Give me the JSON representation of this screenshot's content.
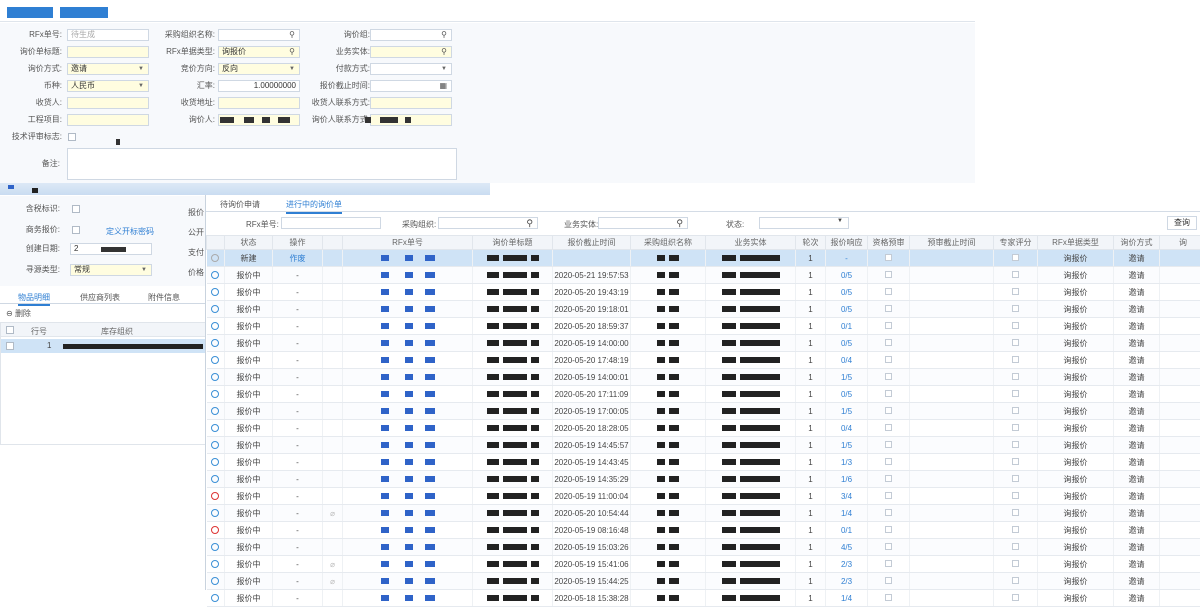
{
  "colors": {
    "accent": "#2f7fd3",
    "selected_row": "#cfe3f6",
    "required": "#fffde0"
  },
  "back_form": {
    "rows": [
      [
        {
          "label": "RFx单号:",
          "value": "待生成",
          "kind": "plain"
        },
        {
          "label": "采购组织名称:",
          "value": "",
          "kind": "search"
        },
        {
          "label": "询价组:",
          "value": "",
          "kind": "search"
        }
      ],
      [
        {
          "label": "询价单标题:",
          "value": "",
          "kind": "req"
        },
        {
          "label": "RFx单据类型:",
          "value": "询报价",
          "kind": "reqsearch"
        },
        {
          "label": "业务实体:",
          "value": "",
          "kind": "reqsearch"
        }
      ],
      [
        {
          "label": "询价方式:",
          "value": "邀请",
          "kind": "reqdd"
        },
        {
          "label": "竞价方向:",
          "value": "反向",
          "kind": "reqdd"
        },
        {
          "label": "付款方式:",
          "value": "",
          "kind": "dd"
        }
      ],
      [
        {
          "label": "币种:",
          "value": "人民币",
          "kind": "reqdd"
        },
        {
          "label": "汇率:",
          "value": "1.00000000",
          "kind": "num"
        },
        {
          "label": "报价截止时间:",
          "value": "",
          "kind": "cal"
        }
      ],
      [
        {
          "label": "收货人:",
          "value": "",
          "kind": "req"
        },
        {
          "label": "收货地址:",
          "value": "",
          "kind": "req"
        },
        {
          "label": "收货人联系方式:",
          "value": "",
          "kind": "req"
        }
      ],
      [
        {
          "label": "工程项目:",
          "value": "",
          "kind": "req"
        },
        {
          "label": "询价人:",
          "value": "",
          "kind": "req"
        },
        {
          "label": "询价人联系方式:",
          "value": "",
          "kind": "req"
        }
      ]
    ],
    "tech_flag_label": "技术评审标志:",
    "remark_label": "备注:",
    "lower": {
      "contains_label": "含税标识:",
      "bid_label": "商务报价:",
      "bid_link": "定义开标密码",
      "created_label": "创建日期:",
      "created_value": "2",
      "purchase_type_label": "寻源类型:",
      "purchase_type_value": "常规",
      "right_labels": [
        "报价",
        "公开",
        "支付",
        "价格"
      ]
    },
    "bottom_tabs": [
      "物品明细",
      "供应商列表",
      "附件信息"
    ],
    "delete_label": "删除",
    "grid_headers": [
      "行号",
      "库存组织"
    ],
    "grid_row_no": "1"
  },
  "front": {
    "tabs": [
      "待询价申请",
      "进行中的询价单"
    ],
    "filters": {
      "rfx_no": "RFx单号:",
      "org": "采购组织:",
      "entity": "业务实体:",
      "status": "状态:",
      "query": "查询"
    },
    "headers": [
      "",
      "状态",
      "操作",
      "",
      "RFx单号",
      "询价单标题",
      "报价截止时间",
      "采购组织名称",
      "业务实体",
      "轮次",
      "报价响应",
      "资格预审",
      "预审截止时间",
      "专家评分",
      "RFx单据类型",
      "询价方式",
      "询"
    ],
    "rows": [
      {
        "icon": "gr",
        "status": "新建",
        "op": "作废",
        "clip": false,
        "deadline": "",
        "round": "1",
        "resp": "-",
        "type": "询报价",
        "method": "邀请"
      },
      {
        "icon": "b",
        "status": "报价中",
        "op": "-",
        "clip": false,
        "deadline": "2020-05-21 19:57:53",
        "round": "1",
        "resp": "0/5",
        "type": "询报价",
        "method": "邀请"
      },
      {
        "icon": "b",
        "status": "报价中",
        "op": "-",
        "clip": false,
        "deadline": "2020-05-20 19:43:19",
        "round": "1",
        "resp": "0/5",
        "type": "询报价",
        "method": "邀请"
      },
      {
        "icon": "b",
        "status": "报价中",
        "op": "-",
        "clip": false,
        "deadline": "2020-05-20 19:18:01",
        "round": "1",
        "resp": "0/5",
        "type": "询报价",
        "method": "邀请"
      },
      {
        "icon": "b",
        "status": "报价中",
        "op": "-",
        "clip": false,
        "deadline": "2020-05-20 18:59:37",
        "round": "1",
        "resp": "0/1",
        "type": "询报价",
        "method": "邀请"
      },
      {
        "icon": "b",
        "status": "报价中",
        "op": "-",
        "clip": false,
        "deadline": "2020-05-19 14:00:00",
        "round": "1",
        "resp": "0/5",
        "type": "询报价",
        "method": "邀请"
      },
      {
        "icon": "b",
        "status": "报价中",
        "op": "-",
        "clip": false,
        "deadline": "2020-05-20 17:48:19",
        "round": "1",
        "resp": "0/4",
        "type": "询报价",
        "method": "邀请"
      },
      {
        "icon": "b",
        "status": "报价中",
        "op": "-",
        "clip": false,
        "deadline": "2020-05-19 14:00:01",
        "round": "1",
        "resp": "1/5",
        "type": "询报价",
        "method": "邀请"
      },
      {
        "icon": "b",
        "status": "报价中",
        "op": "-",
        "clip": false,
        "deadline": "2020-05-20 17:11:09",
        "round": "1",
        "resp": "0/5",
        "type": "询报价",
        "method": "邀请"
      },
      {
        "icon": "b",
        "status": "报价中",
        "op": "-",
        "clip": false,
        "deadline": "2020-05-19 17:00:05",
        "round": "1",
        "resp": "1/5",
        "type": "询报价",
        "method": "邀请"
      },
      {
        "icon": "b",
        "status": "报价中",
        "op": "-",
        "clip": false,
        "deadline": "2020-05-20 18:28:05",
        "round": "1",
        "resp": "0/4",
        "type": "询报价",
        "method": "邀请"
      },
      {
        "icon": "b",
        "status": "报价中",
        "op": "-",
        "clip": false,
        "deadline": "2020-05-19 14:45:57",
        "round": "1",
        "resp": "1/5",
        "type": "询报价",
        "method": "邀请"
      },
      {
        "icon": "b",
        "status": "报价中",
        "op": "-",
        "clip": false,
        "deadline": "2020-05-19 14:43:45",
        "round": "1",
        "resp": "1/3",
        "type": "询报价",
        "method": "邀请"
      },
      {
        "icon": "b",
        "status": "报价中",
        "op": "-",
        "clip": false,
        "deadline": "2020-05-19 14:35:29",
        "round": "1",
        "resp": "1/6",
        "type": "询报价",
        "method": "邀请"
      },
      {
        "icon": "r",
        "status": "报价中",
        "op": "-",
        "clip": false,
        "deadline": "2020-05-19 11:00:04",
        "round": "1",
        "resp": "3/4",
        "type": "询报价",
        "method": "邀请"
      },
      {
        "icon": "b",
        "status": "报价中",
        "op": "-",
        "clip": true,
        "deadline": "2020-05-20 10:54:44",
        "round": "1",
        "resp": "1/4",
        "type": "询报价",
        "method": "邀请"
      },
      {
        "icon": "r",
        "status": "报价中",
        "op": "-",
        "clip": false,
        "deadline": "2020-05-19 08:16:48",
        "round": "1",
        "resp": "0/1",
        "type": "询报价",
        "method": "邀请"
      },
      {
        "icon": "b",
        "status": "报价中",
        "op": "-",
        "clip": false,
        "deadline": "2020-05-19 15:03:26",
        "round": "1",
        "resp": "4/5",
        "type": "询报价",
        "method": "邀请"
      },
      {
        "icon": "b",
        "status": "报价中",
        "op": "-",
        "clip": true,
        "deadline": "2020-05-19 15:41:06",
        "round": "1",
        "resp": "2/3",
        "type": "询报价",
        "method": "邀请"
      },
      {
        "icon": "b",
        "status": "报价中",
        "op": "-",
        "clip": true,
        "deadline": "2020-05-19 15:44:25",
        "round": "1",
        "resp": "2/3",
        "type": "询报价",
        "method": "邀请"
      },
      {
        "icon": "b",
        "status": "报价中",
        "op": "-",
        "clip": false,
        "deadline": "2020-05-18 15:38:28",
        "round": "1",
        "resp": "1/4",
        "type": "询报价",
        "method": "邀请"
      }
    ]
  }
}
